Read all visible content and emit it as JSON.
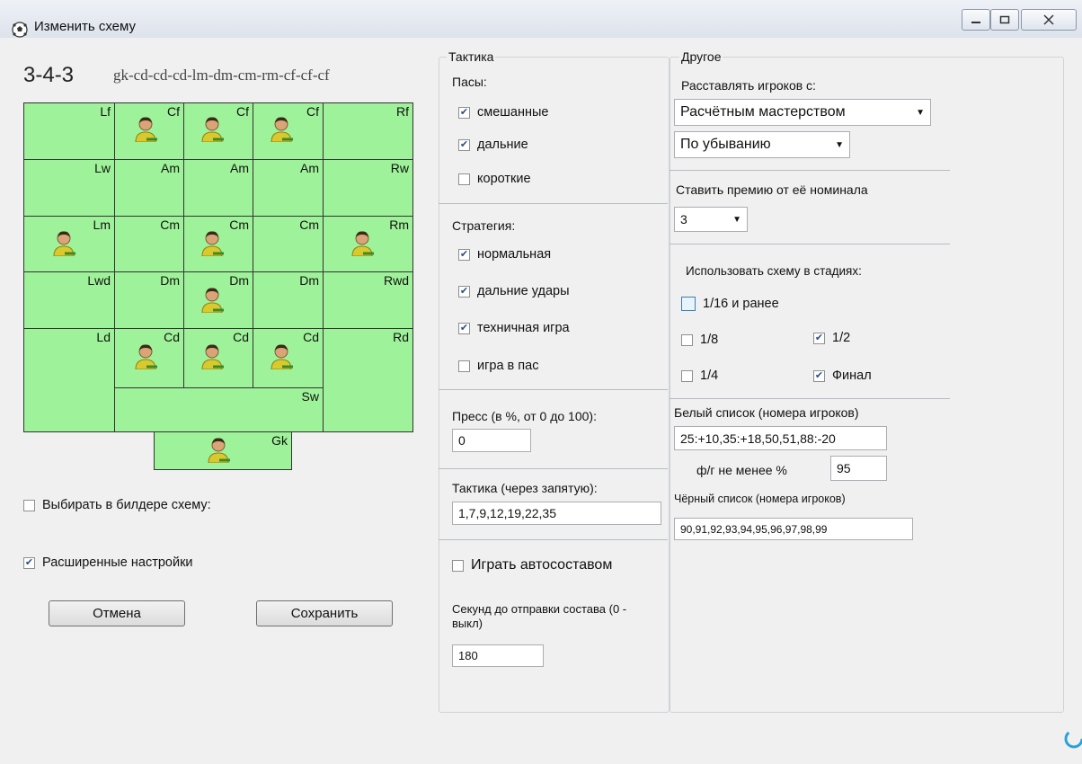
{
  "window": {
    "title": "Изменить схему",
    "icon": "soccer-ball-icon"
  },
  "formation": {
    "name": "3-4-3",
    "codes": "gk-cd-cd-cd-lm-dm-cm-rm-cf-cf-cf",
    "labels": {
      "lf": "Lf",
      "cf1": "Cf",
      "cf2": "Cf",
      "cf3": "Cf",
      "rf": "Rf",
      "lw": "Lw",
      "am1": "Am",
      "am2": "Am",
      "am3": "Am",
      "rw": "Rw",
      "lm": "Lm",
      "cm1": "Cm",
      "cm2": "Cm",
      "cm3": "Cm",
      "rm": "Rm",
      "lwd": "Lwd",
      "dm1": "Dm",
      "dm2": "Dm",
      "dm3": "Dm",
      "rwd": "Rwd",
      "ld": "Ld",
      "cd1": "Cd",
      "cd2": "Cd",
      "cd3": "Cd",
      "rd": "Rd",
      "sw": "Sw",
      "gk": "Gk"
    },
    "field_color": "#9ef299"
  },
  "left_options": {
    "choose_in_builder": "Выбирать в билдере схему:",
    "advanced": "Расширенные настройки"
  },
  "buttons": {
    "cancel": "Отмена",
    "save": "Сохранить"
  },
  "tactics": {
    "title": "Тактика",
    "passes_label": "Пасы:",
    "passes": [
      {
        "label": "смешанные",
        "checked": true
      },
      {
        "label": "дальние",
        "checked": true
      },
      {
        "label": "короткие",
        "checked": false
      }
    ],
    "strategy_label": "Стратегия:",
    "strategy": [
      {
        "label": "нормальная",
        "checked": true
      },
      {
        "label": "дальние удары",
        "checked": true
      },
      {
        "label": "техничная игра",
        "checked": true
      },
      {
        "label": "игра в пас",
        "checked": false
      }
    ],
    "press_label": "Пресс (в %, от 0 до 100):",
    "press_value": "0",
    "tactic_list_label": "Тактика (через запятую):",
    "tactic_list_value": "1,7,9,12,19,22,35",
    "auto_lineup": "Играть автосоставом",
    "seconds_label": "Секунд до отправки состава (0 - выкл)",
    "seconds_value": "180"
  },
  "other": {
    "title": "Другое",
    "arrange_label": "Расставлять игроков с:",
    "arrange_value": "Расчётным мастерством",
    "order_value": "По убыванию",
    "bonus_label": "Ставить премию от её номинала",
    "bonus_value": "3",
    "stages_label": "Использовать схему в стадиях:",
    "stages": {
      "s16": {
        "label": "1/16 и ранее",
        "checked": false
      },
      "s8": {
        "label": "1/8",
        "checked": false
      },
      "s4": {
        "label": "1/4",
        "checked": false
      },
      "s2": {
        "label": "1/2",
        "checked": true
      },
      "final": {
        "label": "Финал",
        "checked": true
      }
    },
    "whitelist_label": "Белый список (номера игроков)",
    "whitelist_value": "25:+10,35:+18,50,51,88:-20",
    "fitness_label": "ф/г не менее %",
    "fitness_value": "95",
    "blacklist_label": "Чёрный список (номера игроков)",
    "blacklist_value": "90,91,92,93,94,95,96,97,98,99"
  }
}
